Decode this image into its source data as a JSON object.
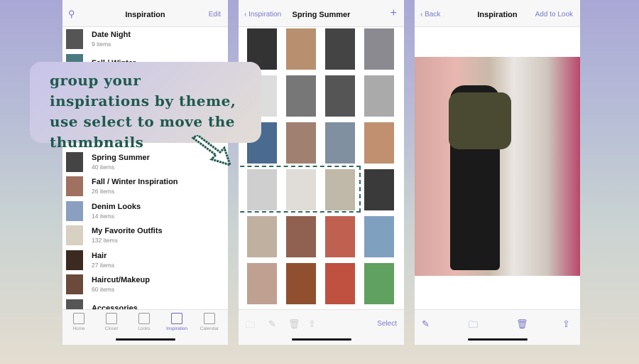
{
  "callout": {
    "text": "group your inspirations by theme, use select to move the thumbnails",
    "accent": "#1f5a4e"
  },
  "screen1": {
    "title": "Inspiration",
    "edit": "Edit",
    "search_icon": "search-icon",
    "items": [
      {
        "name": "Date Night",
        "count": "9 items",
        "color": "#555"
      },
      {
        "name": "Fall / Winter",
        "count": "",
        "color": "#4a7a80"
      },
      {
        "name": "",
        "count": "",
        "color": "#fff"
      },
      {
        "name": "",
        "count": "",
        "color": "#fff"
      },
      {
        "name": "",
        "count": "",
        "color": "#fff"
      },
      {
        "name": "Spring Summer",
        "count": "40 items",
        "color": "#444"
      },
      {
        "name": "Fall / Winter Inspiration",
        "count": "26 items",
        "color": "#a07060"
      },
      {
        "name": "Denim Looks",
        "count": "14 items",
        "color": "#8aa0c0"
      },
      {
        "name": "My Favorite Outfits",
        "count": "132 items",
        "color": "#d8d0c0"
      },
      {
        "name": "Hair",
        "count": "27 items",
        "color": "#3a2a20"
      },
      {
        "name": "Haircut/Makeup",
        "count": "60 items",
        "color": "#6a4a3a"
      },
      {
        "name": "Accessories",
        "count": "",
        "color": "#555"
      }
    ],
    "tabs": [
      {
        "label": "Home"
      },
      {
        "label": "Closet"
      },
      {
        "label": "Looks"
      },
      {
        "label": "Inspiration",
        "active": true
      },
      {
        "label": "Calendar"
      }
    ]
  },
  "screen2": {
    "back": "Inspiration",
    "title": "Spring Summer",
    "add": "+",
    "select": "Select",
    "colors": [
      "#333",
      "#b89070",
      "#444",
      "#8a8a90",
      "#ddd",
      "#777",
      "#555",
      "#aaa",
      "#4a6a90",
      "#a08070",
      "#8090a0",
      "#c09070",
      "#cfcfcf",
      "#e0ddd8",
      "#c0b8a8",
      "#3a3a3a",
      "#c0b0a0",
      "#906050",
      "#c06050",
      "#80a0c0",
      "#c0a090",
      "#905030",
      "#c05040",
      "#60a060"
    ]
  },
  "screen3": {
    "back": "Back",
    "title": "Inspiration",
    "add": "Add to Look"
  }
}
